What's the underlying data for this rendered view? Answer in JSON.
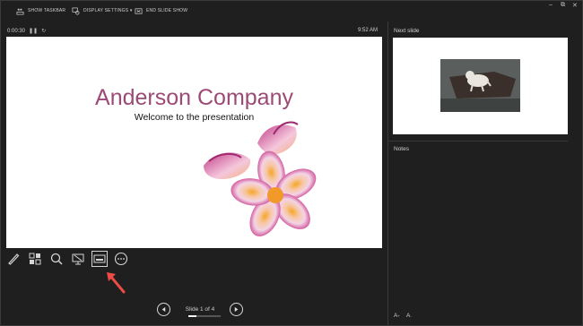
{
  "toolbar": {
    "show_taskbar": "SHOW TASKBAR",
    "display_settings": "DISPLAY SETTINGS ▾",
    "end_slide_show": "END SLIDE SHOW",
    "window_controls": [
      "–",
      "⧉",
      "✕"
    ]
  },
  "timer": {
    "elapsed": "0:00:30",
    "clock": "9:52 AM"
  },
  "slide": {
    "title": "Anderson Company",
    "subtitle": "Welcome to the presentation"
  },
  "tools": [
    {
      "name": "pen-tool-icon"
    },
    {
      "name": "see-all-slides-icon"
    },
    {
      "name": "zoom-icon"
    },
    {
      "name": "black-screen-icon"
    },
    {
      "name": "subtitles-icon",
      "selected": true
    },
    {
      "name": "more-options-icon"
    }
  ],
  "navigation": {
    "counter": "Slide 1 of 4",
    "current": 1,
    "total": 4
  },
  "right_panel": {
    "next_slide_label": "Next slide",
    "notes_label": "Notes"
  },
  "font_controls": {
    "increase": "A",
    "decrease": "A"
  },
  "colors": {
    "background": "#1f1f1f",
    "title": "#9c4a75",
    "arrow": "#ef4b45"
  }
}
